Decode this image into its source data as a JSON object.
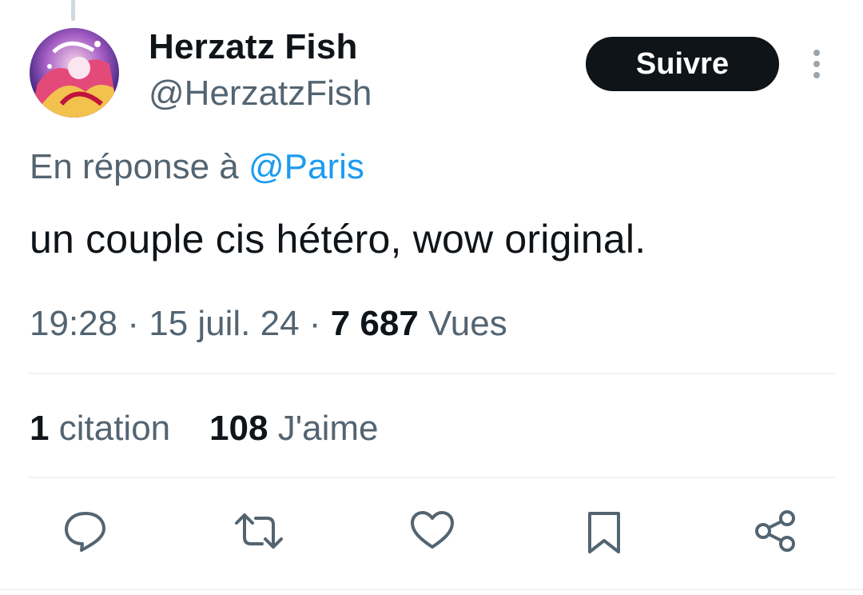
{
  "author": {
    "name": "Herzatz Fish",
    "handle": "@HerzatzFish"
  },
  "follow_label": "Suivre",
  "reply_to": {
    "prefix": "En réponse à ",
    "mention": "@Paris"
  },
  "tweet_text": "un couple cis hétéro, wow original.",
  "meta": {
    "time": "19:28",
    "date": "15 juil. 24",
    "views_count": "7 687",
    "views_label": "Vues"
  },
  "stats": {
    "quotes_count": "1",
    "quotes_label": "citation",
    "likes_count": "108",
    "likes_label": "J'aime"
  },
  "actions": [
    "reply-icon",
    "retweet-icon",
    "like-icon",
    "bookmark-icon",
    "share-icon"
  ],
  "colors": {
    "text_primary": "#0f1419",
    "text_secondary": "#536471",
    "accent": "#1d9bf0",
    "follow_bg": "#0f1419",
    "divider": "#eff3f4"
  }
}
